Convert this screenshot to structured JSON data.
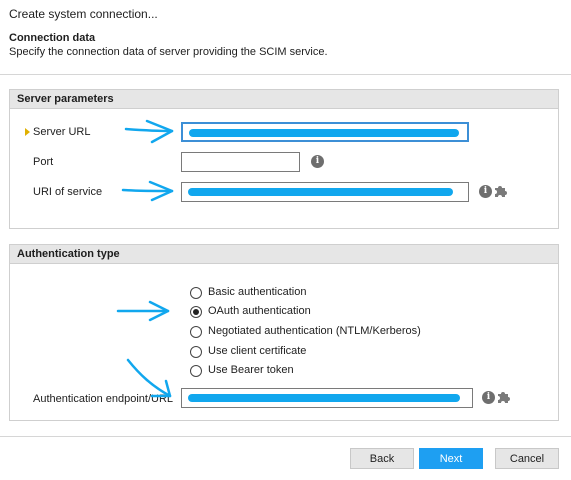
{
  "dialog": {
    "title": "Create system connection...",
    "section_title": "Connection data",
    "section_desc": "Specify the connection data of server providing the SCIM service."
  },
  "server_params": {
    "heading": "Server parameters",
    "server_url_label": "Server URL",
    "port_label": "Port",
    "uri_label": "URI of service"
  },
  "auth": {
    "heading": "Authentication type",
    "options": [
      {
        "label": "Basic authentication",
        "selected": false
      },
      {
        "label": "OAuth authentication",
        "selected": true
      },
      {
        "label": "Negotiated authentication (NTLM/Kerberos)",
        "selected": false
      },
      {
        "label": "Use client certificate",
        "selected": false
      },
      {
        "label": "Use Bearer token",
        "selected": false
      }
    ],
    "endpoint_label": "Authentication endpoint/URL"
  },
  "buttons": {
    "back": "Back",
    "next": "Next",
    "cancel": "Cancel"
  },
  "icons": {
    "info": "info-icon",
    "plugin": "puzzle-icon"
  },
  "colors": {
    "accent": "#1e9ff2",
    "annotation": "#11a7ee",
    "required": "#e0b000"
  }
}
